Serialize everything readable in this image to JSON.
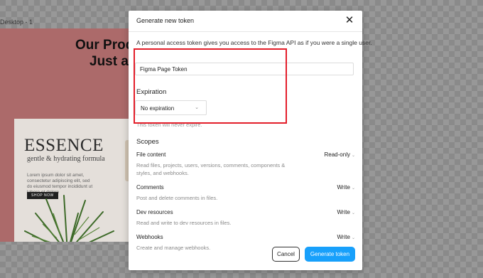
{
  "canvas": {
    "frame_label": "Desktop - 1",
    "headline_line1": "Our Produ",
    "headline_line2": "Just a",
    "product": {
      "brand": "ESSENCE",
      "tagline": "gentle & hydrating formula",
      "blurb": "Lorem ipsum dolor sit amet, consectetur adipiscing elit, sed do eiusmod tempor incididunt ut labore et dolore",
      "cta": "SHOP NOW"
    }
  },
  "modal": {
    "title": "Generate new token",
    "close_glyph": "✕",
    "intro": "A personal access token gives you access to the Figma API as if you were a single user.",
    "token_name_value": "Figma Page Token",
    "expiration": {
      "label": "Expiration",
      "selected": "No expiration",
      "chevron": "⌄",
      "hint": "This token will never expire."
    },
    "scopes_label": "Scopes",
    "scopes": [
      {
        "name": "File content",
        "description": "Read files, projects, users, versions, comments, components & styles, and webhooks.",
        "permission": "Read-only"
      },
      {
        "name": "Comments",
        "description": "Post and delete comments in files.",
        "permission": "Write"
      },
      {
        "name": "Dev resources",
        "description": "Read and write to dev resources in files.",
        "permission": "Write"
      },
      {
        "name": "Webhooks",
        "description": "Create and manage webhooks.",
        "permission": "Write"
      }
    ],
    "perm_chevron": "⌄",
    "cancel_label": "Cancel",
    "generate_label": "Generate token"
  },
  "colors": {
    "primary_button": "#18a0fb",
    "highlight_box": "#e31e2a",
    "frame_background": "#b26e6e"
  }
}
